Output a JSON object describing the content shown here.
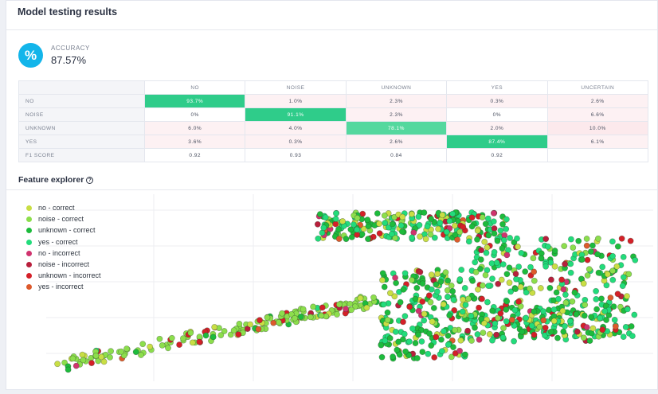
{
  "header": {
    "title": "Model testing results"
  },
  "accuracy": {
    "icon": "percent-icon",
    "icon_glyph": "%",
    "label": "ACCURACY",
    "value": "87.57%"
  },
  "confusion_matrix": {
    "columns": [
      "NO",
      "NOISE",
      "UNKNOWN",
      "YES",
      "UNCERTAIN"
    ],
    "rows": [
      {
        "label": "NO",
        "cells": [
          "93.7%",
          "1.0%",
          "2.3%",
          "0.3%",
          "2.6%"
        ]
      },
      {
        "label": "NOISE",
        "cells": [
          "0%",
          "91.1%",
          "2.3%",
          "0%",
          "6.6%"
        ]
      },
      {
        "label": "UNKNOWN",
        "cells": [
          "6.0%",
          "4.0%",
          "78.1%",
          "2.0%",
          "10.0%"
        ]
      },
      {
        "label": "YES",
        "cells": [
          "3.6%",
          "0.3%",
          "2.6%",
          "87.4%",
          "6.1%"
        ]
      },
      {
        "label": "F1 SCORE",
        "cells": [
          "0.92",
          "0.93",
          "0.84",
          "0.92",
          ""
        ]
      }
    ],
    "colors": {
      "diagonal_strong": "#2fcc8a",
      "diagonal_light": "#54d89e",
      "error_tint": "#fdf1f3",
      "row_header_bg": "#f4f5f8"
    }
  },
  "feature_explorer": {
    "title": "Feature explorer",
    "help_icon": "question-circle-icon",
    "help_glyph": "?",
    "legend": [
      {
        "label": "no - correct",
        "color": "#c9de44"
      },
      {
        "label": "noise - correct",
        "color": "#8cde4c"
      },
      {
        "label": "unknown - correct",
        "color": "#1dbb3c"
      },
      {
        "label": "yes - correct",
        "color": "#22dc7b"
      },
      {
        "label": "no - incorrect",
        "color": "#d0336e"
      },
      {
        "label": "noise - incorrect",
        "color": "#b81f3c"
      },
      {
        "label": "unknown - incorrect",
        "color": "#d42028"
      },
      {
        "label": "yes - incorrect",
        "color": "#dd5a2c"
      }
    ]
  }
}
